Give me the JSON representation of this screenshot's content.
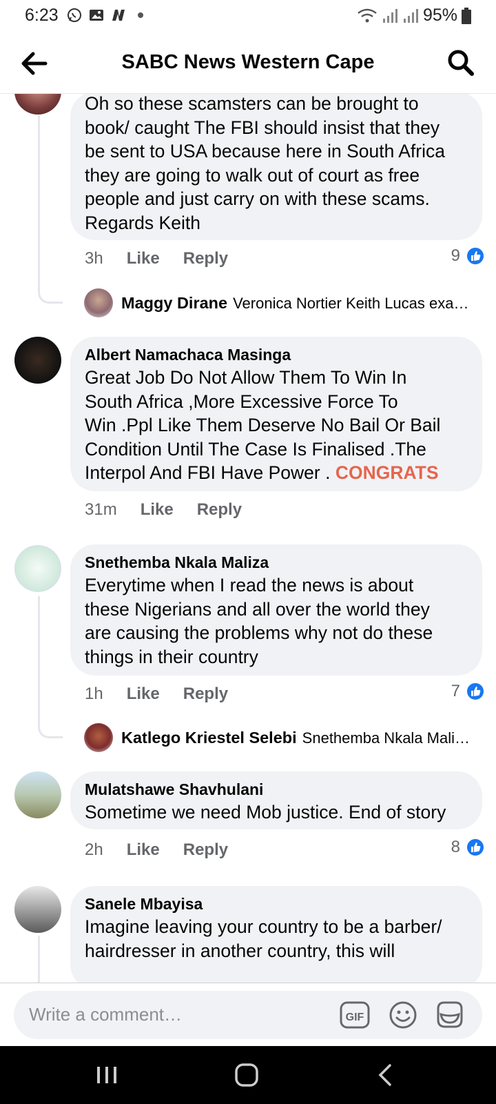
{
  "status": {
    "time": "6:23",
    "battery": "95%"
  },
  "header": {
    "title": "SABC News Western Cape"
  },
  "comments": [
    {
      "text_lines": [
        "Oh so these scamsters can be brought to",
        "book/ caught The FBI should insist that they",
        "be sent to USA because here in South Africa",
        "they are going to walk out of court as free",
        "people and just carry on with these scams.",
        "Regards Keith"
      ],
      "time": "3h",
      "like_label": "Like",
      "reply_label": "Reply",
      "like_count": "9",
      "reply_preview": {
        "name": "Maggy Dirane",
        "text": "Veronica Nortier Keith Lucas exa…"
      }
    },
    {
      "author": "Albert Namachaca Masinga",
      "text_lines": [
        "Great Job Do Not Allow Them To Win In",
        "South Africa ,More Excessive  Force To",
        "Win .Ppl Like Them Deserve No Bail Or Bail",
        "Condition Until The Case  Is Finalised .The",
        "Interpol And FBI  Have Power ."
      ],
      "highlight": "CONGRATS",
      "time": "31m",
      "like_label": "Like",
      "reply_label": "Reply"
    },
    {
      "author": "Snethemba Nkala Maliza",
      "text_lines": [
        "Everytime when I read the news is about",
        "these Nigerians and all over the world they",
        "are causing the problems why not do these",
        "things in their country"
      ],
      "time": "1h",
      "like_label": "Like",
      "reply_label": "Reply",
      "like_count": "7",
      "reply_preview": {
        "name": "Katlego Kriestel Selebi",
        "text": "Snethemba Nkala Mali…"
      }
    },
    {
      "author": "Mulatshawe Shavhulani",
      "text_lines": [
        "Sometime we need Mob justice. End of story"
      ],
      "time": "2h",
      "like_label": "Like",
      "reply_label": "Reply",
      "like_count": "8"
    },
    {
      "author": "Sanele Mbayisa",
      "text_lines": [
        "Imagine leaving your country to be a barber/",
        "hairdresser in another country, this will"
      ]
    }
  ],
  "composer": {
    "placeholder": "Write a comment…",
    "gif_label": "GIF"
  },
  "colors": {
    "accent": "#1877f2",
    "bubble": "#f0f2f5",
    "highlight": "#e6654d",
    "muted": "#65676b"
  },
  "icons": [
    "back-arrow-icon",
    "search-icon",
    "gif-icon",
    "emoji-icon",
    "sticker-icon",
    "like-thumb-icon"
  ]
}
